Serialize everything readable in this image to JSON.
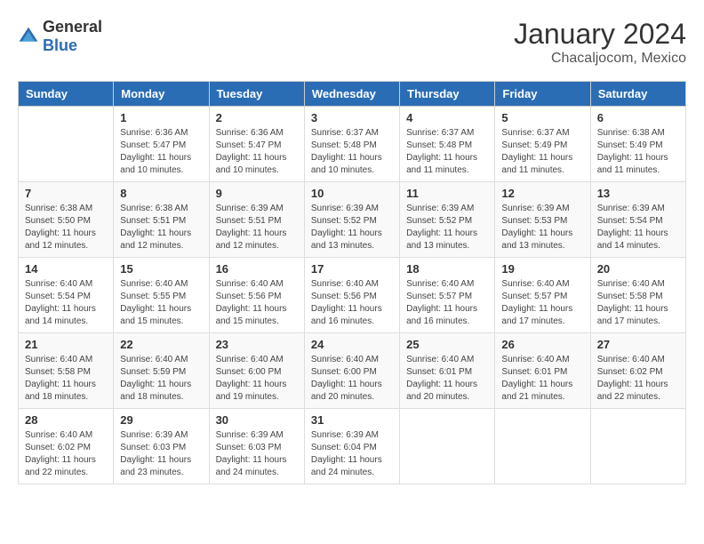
{
  "header": {
    "logo_general": "General",
    "logo_blue": "Blue",
    "month": "January 2024",
    "location": "Chacaljocom, Mexico"
  },
  "days_of_week": [
    "Sunday",
    "Monday",
    "Tuesday",
    "Wednesday",
    "Thursday",
    "Friday",
    "Saturday"
  ],
  "weeks": [
    [
      {
        "day": "",
        "sunrise": "",
        "sunset": "",
        "daylight": ""
      },
      {
        "day": "1",
        "sunrise": "Sunrise: 6:36 AM",
        "sunset": "Sunset: 5:47 PM",
        "daylight": "Daylight: 11 hours and 10 minutes."
      },
      {
        "day": "2",
        "sunrise": "Sunrise: 6:36 AM",
        "sunset": "Sunset: 5:47 PM",
        "daylight": "Daylight: 11 hours and 10 minutes."
      },
      {
        "day": "3",
        "sunrise": "Sunrise: 6:37 AM",
        "sunset": "Sunset: 5:48 PM",
        "daylight": "Daylight: 11 hours and 10 minutes."
      },
      {
        "day": "4",
        "sunrise": "Sunrise: 6:37 AM",
        "sunset": "Sunset: 5:48 PM",
        "daylight": "Daylight: 11 hours and 11 minutes."
      },
      {
        "day": "5",
        "sunrise": "Sunrise: 6:37 AM",
        "sunset": "Sunset: 5:49 PM",
        "daylight": "Daylight: 11 hours and 11 minutes."
      },
      {
        "day": "6",
        "sunrise": "Sunrise: 6:38 AM",
        "sunset": "Sunset: 5:49 PM",
        "daylight": "Daylight: 11 hours and 11 minutes."
      }
    ],
    [
      {
        "day": "7",
        "sunrise": "Sunrise: 6:38 AM",
        "sunset": "Sunset: 5:50 PM",
        "daylight": "Daylight: 11 hours and 12 minutes."
      },
      {
        "day": "8",
        "sunrise": "Sunrise: 6:38 AM",
        "sunset": "Sunset: 5:51 PM",
        "daylight": "Daylight: 11 hours and 12 minutes."
      },
      {
        "day": "9",
        "sunrise": "Sunrise: 6:39 AM",
        "sunset": "Sunset: 5:51 PM",
        "daylight": "Daylight: 11 hours and 12 minutes."
      },
      {
        "day": "10",
        "sunrise": "Sunrise: 6:39 AM",
        "sunset": "Sunset: 5:52 PM",
        "daylight": "Daylight: 11 hours and 13 minutes."
      },
      {
        "day": "11",
        "sunrise": "Sunrise: 6:39 AM",
        "sunset": "Sunset: 5:52 PM",
        "daylight": "Daylight: 11 hours and 13 minutes."
      },
      {
        "day": "12",
        "sunrise": "Sunrise: 6:39 AM",
        "sunset": "Sunset: 5:53 PM",
        "daylight": "Daylight: 11 hours and 13 minutes."
      },
      {
        "day": "13",
        "sunrise": "Sunrise: 6:39 AM",
        "sunset": "Sunset: 5:54 PM",
        "daylight": "Daylight: 11 hours and 14 minutes."
      }
    ],
    [
      {
        "day": "14",
        "sunrise": "Sunrise: 6:40 AM",
        "sunset": "Sunset: 5:54 PM",
        "daylight": "Daylight: 11 hours and 14 minutes."
      },
      {
        "day": "15",
        "sunrise": "Sunrise: 6:40 AM",
        "sunset": "Sunset: 5:55 PM",
        "daylight": "Daylight: 11 hours and 15 minutes."
      },
      {
        "day": "16",
        "sunrise": "Sunrise: 6:40 AM",
        "sunset": "Sunset: 5:56 PM",
        "daylight": "Daylight: 11 hours and 15 minutes."
      },
      {
        "day": "17",
        "sunrise": "Sunrise: 6:40 AM",
        "sunset": "Sunset: 5:56 PM",
        "daylight": "Daylight: 11 hours and 16 minutes."
      },
      {
        "day": "18",
        "sunrise": "Sunrise: 6:40 AM",
        "sunset": "Sunset: 5:57 PM",
        "daylight": "Daylight: 11 hours and 16 minutes."
      },
      {
        "day": "19",
        "sunrise": "Sunrise: 6:40 AM",
        "sunset": "Sunset: 5:57 PM",
        "daylight": "Daylight: 11 hours and 17 minutes."
      },
      {
        "day": "20",
        "sunrise": "Sunrise: 6:40 AM",
        "sunset": "Sunset: 5:58 PM",
        "daylight": "Daylight: 11 hours and 17 minutes."
      }
    ],
    [
      {
        "day": "21",
        "sunrise": "Sunrise: 6:40 AM",
        "sunset": "Sunset: 5:58 PM",
        "daylight": "Daylight: 11 hours and 18 minutes."
      },
      {
        "day": "22",
        "sunrise": "Sunrise: 6:40 AM",
        "sunset": "Sunset: 5:59 PM",
        "daylight": "Daylight: 11 hours and 18 minutes."
      },
      {
        "day": "23",
        "sunrise": "Sunrise: 6:40 AM",
        "sunset": "Sunset: 6:00 PM",
        "daylight": "Daylight: 11 hours and 19 minutes."
      },
      {
        "day": "24",
        "sunrise": "Sunrise: 6:40 AM",
        "sunset": "Sunset: 6:00 PM",
        "daylight": "Daylight: 11 hours and 20 minutes."
      },
      {
        "day": "25",
        "sunrise": "Sunrise: 6:40 AM",
        "sunset": "Sunset: 6:01 PM",
        "daylight": "Daylight: 11 hours and 20 minutes."
      },
      {
        "day": "26",
        "sunrise": "Sunrise: 6:40 AM",
        "sunset": "Sunset: 6:01 PM",
        "daylight": "Daylight: 11 hours and 21 minutes."
      },
      {
        "day": "27",
        "sunrise": "Sunrise: 6:40 AM",
        "sunset": "Sunset: 6:02 PM",
        "daylight": "Daylight: 11 hours and 22 minutes."
      }
    ],
    [
      {
        "day": "28",
        "sunrise": "Sunrise: 6:40 AM",
        "sunset": "Sunset: 6:02 PM",
        "daylight": "Daylight: 11 hours and 22 minutes."
      },
      {
        "day": "29",
        "sunrise": "Sunrise: 6:39 AM",
        "sunset": "Sunset: 6:03 PM",
        "daylight": "Daylight: 11 hours and 23 minutes."
      },
      {
        "day": "30",
        "sunrise": "Sunrise: 6:39 AM",
        "sunset": "Sunset: 6:03 PM",
        "daylight": "Daylight: 11 hours and 24 minutes."
      },
      {
        "day": "31",
        "sunrise": "Sunrise: 6:39 AM",
        "sunset": "Sunset: 6:04 PM",
        "daylight": "Daylight: 11 hours and 24 minutes."
      },
      {
        "day": "",
        "sunrise": "",
        "sunset": "",
        "daylight": ""
      },
      {
        "day": "",
        "sunrise": "",
        "sunset": "",
        "daylight": ""
      },
      {
        "day": "",
        "sunrise": "",
        "sunset": "",
        "daylight": ""
      }
    ]
  ]
}
